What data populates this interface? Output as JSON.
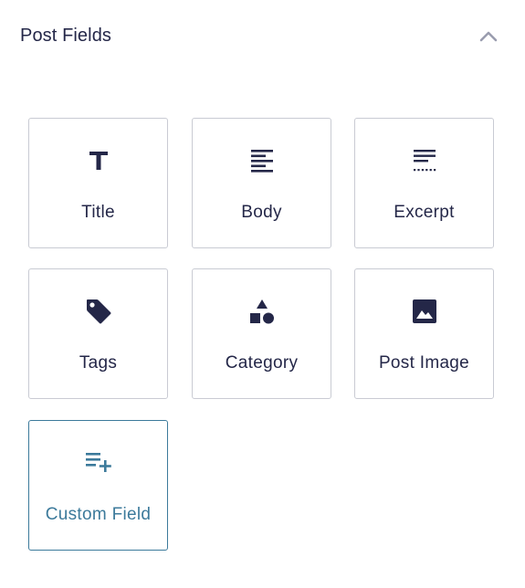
{
  "panel": {
    "title": "Post Fields",
    "collapse_icon": "chevron-up-icon"
  },
  "colors": {
    "text": "#242748",
    "border": "#c9cbd3",
    "active": "#3c7a9b",
    "chevron": "#9a9daf"
  },
  "fields": [
    {
      "label": "Title",
      "icon": "title-icon"
    },
    {
      "label": "Body",
      "icon": "align-left-icon"
    },
    {
      "label": "Excerpt",
      "icon": "excerpt-icon"
    },
    {
      "label": "Tags",
      "icon": "tag-icon"
    },
    {
      "label": "Category",
      "icon": "shapes-icon"
    },
    {
      "label": "Post Image",
      "icon": "image-icon"
    },
    {
      "label": "Custom Field",
      "icon": "list-add-icon",
      "active": true
    }
  ]
}
